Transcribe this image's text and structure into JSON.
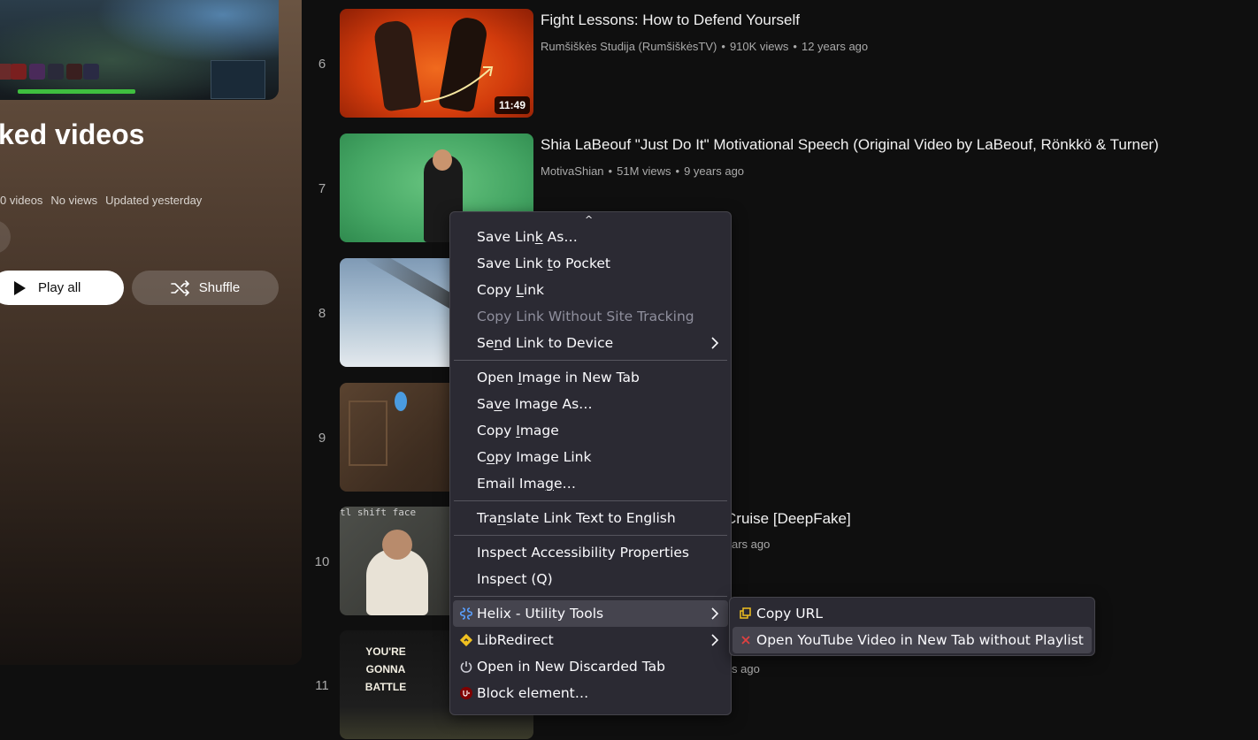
{
  "playlist": {
    "title": "ked videos",
    "meta": [
      "0 videos",
      "No views",
      "Updated yesterday"
    ],
    "play_all_label": "Play all",
    "shuffle_label": "Shuffle"
  },
  "videos": [
    {
      "index": "6",
      "title": "Fight Lessons: How to Defend Yourself",
      "channel": "Rumšiškės Studija (RumšiškėsTV)",
      "views": "910K views",
      "age": "12 years ago",
      "duration": "11:49"
    },
    {
      "index": "7",
      "title": "Shia LaBeouf \"Just Do It\" Motivational Speech (Original Video by LaBeouf, Rönkkö & Turner)",
      "channel": "MotivaShian",
      "views": "51M views",
      "age": "9 years ago"
    },
    {
      "index": "8"
    },
    {
      "index": "9"
    },
    {
      "index": "10",
      "title": "Cruise [DeepFake]",
      "partial_meta": "ars ago",
      "thumb_caption": "tl shift face"
    },
    {
      "index": "11",
      "partial_meta": "s ago",
      "thumb_text": "YOU'RE GONNA BATTLE"
    }
  ],
  "context_menu": {
    "items": [
      {
        "pre": "Save Lin",
        "key": "k",
        "post": " As…"
      },
      {
        "pre": "Save Link ",
        "key": "t",
        "post": "o Pocket"
      },
      {
        "pre": "Copy ",
        "key": "L",
        "post": "ink"
      },
      {
        "pre": "Copy Link Without Site Tracking",
        "key": "",
        "post": "",
        "disabled": true
      },
      {
        "pre": "Se",
        "key": "n",
        "post": "d Link to Device"
      },
      {
        "pre": "Open ",
        "key": "I",
        "post": "mage in New Tab"
      },
      {
        "pre": "Sa",
        "key": "v",
        "post": "e Image As…"
      },
      {
        "pre": "Copy ",
        "key": "I",
        "post": "mage"
      },
      {
        "pre": "C",
        "key": "o",
        "post": "py Image Link"
      },
      {
        "pre": "Email Ima",
        "key": "g",
        "post": "e…"
      },
      {
        "pre": "Tra",
        "key": "n",
        "post": "slate Link Text to English"
      },
      {
        "pre": "Inspect Accessibility Properties",
        "key": "",
        "post": ""
      },
      {
        "pre": "Inspect (Q)",
        "key": "",
        "post": ""
      },
      {
        "pre": "Helix - Utility Tools",
        "key": "",
        "post": ""
      },
      {
        "pre": "LibRedirect",
        "key": "",
        "post": ""
      },
      {
        "pre": "Open in New Discarded Tab",
        "key": "",
        "post": ""
      },
      {
        "pre": "Block element…",
        "key": "",
        "post": ""
      }
    ]
  },
  "submenu": {
    "items": [
      "Copy URL",
      "Open YouTube Video in New Tab without Playlist"
    ]
  },
  "colors": {
    "accent_yellow": "#f0c020",
    "menu_bg": "#2b2a33",
    "ublock_red": "#800000"
  }
}
